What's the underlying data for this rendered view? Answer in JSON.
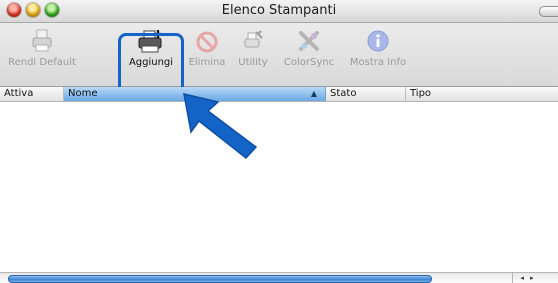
{
  "window": {
    "title": "Elenco Stampanti"
  },
  "toolbar": {
    "items": [
      {
        "label": "Rendi Default",
        "icon": "printer-default-icon",
        "enabled": false
      },
      {
        "label": "Aggiungi",
        "icon": "add-printer-icon",
        "enabled": true
      },
      {
        "label": "Elimina",
        "icon": "delete-icon",
        "enabled": false
      },
      {
        "label": "Utility",
        "icon": "printer-utility-icon",
        "enabled": false
      },
      {
        "label": "ColorSync",
        "icon": "colorsync-icon",
        "enabled": false
      },
      {
        "label": "Mostra Info",
        "icon": "info-icon",
        "enabled": false
      }
    ],
    "highlight_color": "#1464c8"
  },
  "table": {
    "columns": [
      {
        "label": "Attiva"
      },
      {
        "label": "Nome",
        "sorted": true
      },
      {
        "label": "Stato"
      },
      {
        "label": "Tipo"
      }
    ],
    "sort_indicator": "▲",
    "rows": []
  },
  "scrollbar": {
    "arrows": "◂ ▸"
  },
  "colors": {
    "accent": "#1464c8",
    "header_selected": "#6aa9e6"
  }
}
